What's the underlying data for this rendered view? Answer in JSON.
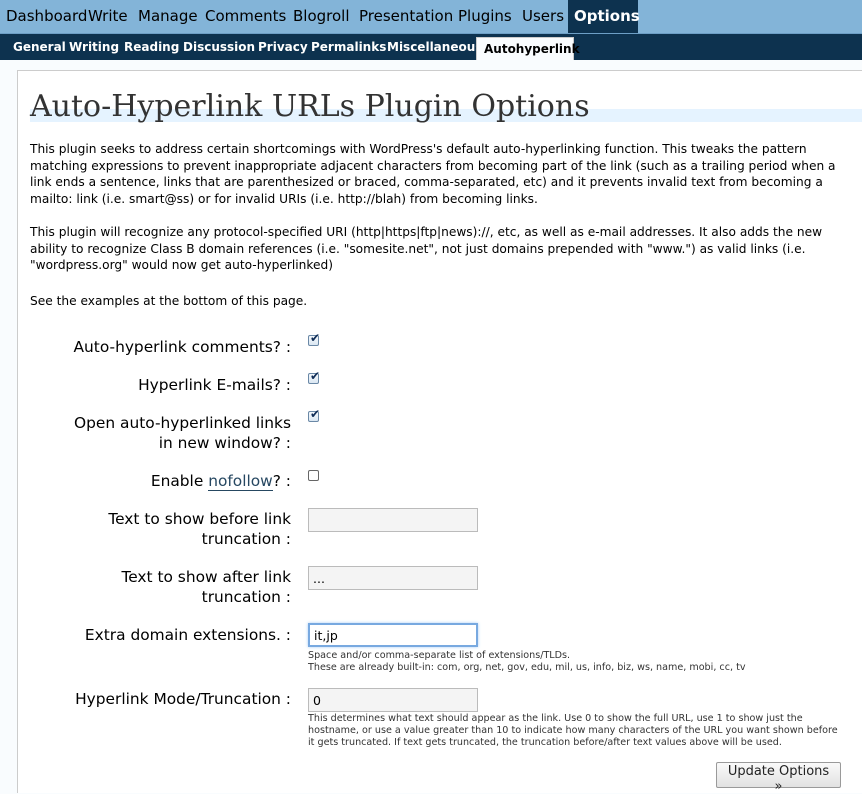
{
  "admin_menu": [
    "Dashboard",
    "Write",
    "Manage",
    "Comments",
    "Blogroll",
    "Presentation",
    "Plugins",
    "Users",
    "Options"
  ],
  "sub_menu": [
    "General",
    "Writing",
    "Reading",
    "Discussion",
    "Privacy",
    "Permalinks",
    "Miscellaneous",
    "Autohyperlink"
  ],
  "page_title": "Auto-Hyperlink URLs Plugin Options",
  "intro": [
    "This plugin seeks to address certain shortcomings with WordPress's default auto-hyperlinking function. This tweaks the pattern matching expressions to prevent inappropriate adjacent characters from becoming part of the link (such as a trailing period when a link ends a sentence, links that are parenthesized or braced, comma-separated, etc) and it prevents invalid text from becoming a mailto: link (i.e. smart@ss) or for invalid URIs (i.e. http://blah) from becoming links.",
    "This plugin will recognize any protocol-specified URI (http|https|ftp|news)://, etc, as well as e-mail addresses. It also adds the new ability to recognize Class B domain references (i.e. \"somesite.net\", not just domains prepended with \"www.\") as valid links (i.e. \"wordpress.org\" would now get auto-hyperlinked)",
    "See the examples at the bottom of this page."
  ],
  "options": {
    "comments": {
      "label": "Auto-hyperlink comments? :",
      "checked": true
    },
    "emails": {
      "label": "Hyperlink E-mails? :",
      "checked": true
    },
    "new_window": {
      "label_line1": "Open auto-hyperlinked links",
      "label_line2": "in new window? :",
      "checked": true
    },
    "nofollow": {
      "label_pre": "Enable ",
      "label_link": "nofollow",
      "label_post": "? :",
      "checked": false
    },
    "before": {
      "label_line1": "Text to show before link",
      "label_line2": "truncation :",
      "value": ""
    },
    "after": {
      "label_line1": "Text to show after link",
      "label_line2": "truncation :",
      "value": "..."
    },
    "extensions": {
      "label": "Extra domain extensions. :",
      "value": "it,jp",
      "hint_line1": "Space and/or comma-separate list of extensions/TLDs.",
      "hint_line2": "These are already built-in: com, org, net, gov, edu, mil, us, info, biz, ws, name, mobi, cc, tv"
    },
    "mode": {
      "label": "Hyperlink Mode/Truncation :",
      "value": "0",
      "hint": "This determines what text should appear as the link. Use 0 to show the full URL, use 1 to show just the hostname, or use a value greater than 10 to indicate how many characters of the URL you want shown before it gets truncated. If text gets truncated, the truncation before/after text values above will be used."
    }
  },
  "update_button": "Update Options »"
}
